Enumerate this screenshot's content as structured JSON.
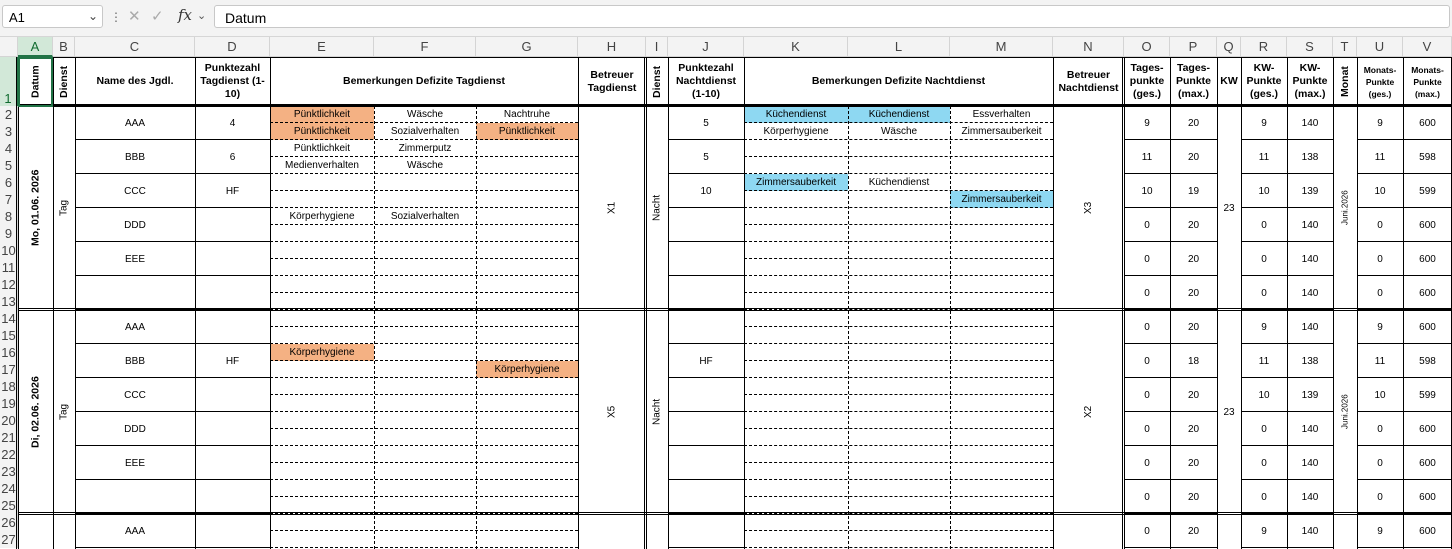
{
  "formula_bar": {
    "name_box": "A1",
    "dropdown_icon": "chevron-down-icon",
    "options_icon": "more-vertical-icon",
    "cancel_icon": "cancel-x-icon",
    "enter_icon": "checkmark-icon",
    "fx_label": "fx",
    "formula_value": "Datum"
  },
  "colors": {
    "orange_highlight": "#f4b183",
    "blue_highlight": "#8ed8f2",
    "selection_accent": "#217346"
  },
  "columns": [
    "A",
    "B",
    "C",
    "D",
    "E",
    "F",
    "G",
    "H",
    "I",
    "J",
    "K",
    "L",
    "M",
    "N",
    "O",
    "P",
    "Q",
    "R",
    "S",
    "T",
    "U",
    "V"
  ],
  "rows": [
    "1",
    "2",
    "3",
    "4",
    "5",
    "6",
    "7",
    "8",
    "9",
    "10",
    "11",
    "12",
    "13",
    "14",
    "15",
    "16",
    "17",
    "18",
    "19",
    "20",
    "21",
    "22",
    "23",
    "24",
    "25",
    "26",
    "27"
  ],
  "header": {
    "datum": "Datum",
    "dienst": "Dienst",
    "name": "Name des Jgdl.",
    "punktezahl_tag": "Punktezahl Tagdienst (1-10)",
    "bemerkungen_tag": "Bemerkungen Defizite Tagdienst",
    "betreuer_tag": "Betreuer Tagdienst",
    "dienst_nacht": "Dienst",
    "punktezahl_nacht": "Punktezahl Nachtdienst (1-10)",
    "bemerkungen_nacht": "Bemerkungen Defizite Nachtdienst",
    "betreuer_nacht": "Betreuer Nachtdienst",
    "tagespunkte_ges": "Tages-punkte (ges.)",
    "tagespunkte_max": "Tages-Punkte (max.)",
    "kw": "KW",
    "kw_punkte_ges": "KW-Punkte (ges.)",
    "kw_punkte_max": "KW-Punkte (max.)",
    "monat": "Monat",
    "monats_punkte_ges": "Monats-Punkte (ges.)",
    "monats_punkte_max": "Monats-Punkte (max.)"
  },
  "blocks": [
    {
      "date": "Mo, 01.06. 2026",
      "dienst_tag": "Tag",
      "betreuer_tag": "X1",
      "dienst_nacht": "Nacht",
      "betreuer_nacht": "X3",
      "kw": "23",
      "monat": "Juni.2026",
      "people": [
        {
          "name": "AAA",
          "pt_tag": "4",
          "pt_nacht": "5",
          "tages_ges": "9",
          "tages_max": "20",
          "kw_ges": "9",
          "kw_max": "140",
          "mon_ges": "9",
          "mon_max": "600"
        },
        {
          "name": "BBB",
          "pt_tag": "6",
          "pt_nacht": "5",
          "tages_ges": "11",
          "tages_max": "20",
          "kw_ges": "11",
          "kw_max": "138",
          "mon_ges": "11",
          "mon_max": "598"
        },
        {
          "name": "CCC",
          "pt_tag": "HF",
          "pt_nacht": "10",
          "tages_ges": "10",
          "tages_max": "19",
          "kw_ges": "10",
          "kw_max": "139",
          "mon_ges": "10",
          "mon_max": "599"
        },
        {
          "name": "DDD",
          "pt_tag": "",
          "pt_nacht": "",
          "tages_ges": "0",
          "tages_max": "20",
          "kw_ges": "0",
          "kw_max": "140",
          "mon_ges": "0",
          "mon_max": "600"
        },
        {
          "name": "EEE",
          "pt_tag": "",
          "pt_nacht": "",
          "tages_ges": "0",
          "tages_max": "20",
          "kw_ges": "0",
          "kw_max": "140",
          "mon_ges": "0",
          "mon_max": "600"
        },
        {
          "name": "",
          "pt_tag": "",
          "pt_nacht": "",
          "tages_ges": "0",
          "tages_max": "20",
          "kw_ges": "0",
          "kw_max": "140",
          "mon_ges": "0",
          "mon_max": "600"
        }
      ],
      "remarks_tag": [
        [
          "Pünktlichkeit",
          "Wäsche",
          "Nachtruhe"
        ],
        [
          "Pünktlichkeit",
          "Sozialverhalten",
          "Pünktlichkeit"
        ],
        [
          "Pünktlichkeit",
          "Zimmerputz",
          ""
        ],
        [
          "Medienverhalten",
          "Wäsche",
          ""
        ],
        [
          "",
          "",
          ""
        ],
        [
          "",
          "",
          ""
        ],
        [
          "Körperhygiene",
          "Sozialverhalten",
          ""
        ],
        [
          "",
          "",
          ""
        ],
        [
          "",
          "",
          ""
        ],
        [
          "",
          "",
          ""
        ],
        [
          "",
          "",
          ""
        ],
        [
          "",
          "",
          ""
        ]
      ],
      "remarks_nacht": [
        [
          "Küchendienst",
          "Küchendienst",
          "Essverhalten"
        ],
        [
          "Körperhygiene",
          "Wäsche",
          "Zimmersauberkeit"
        ],
        [
          "",
          "",
          ""
        ],
        [
          "",
          "",
          ""
        ],
        [
          "Zimmersauberkeit",
          "Küchendienst",
          ""
        ],
        [
          "",
          "",
          "Zimmersauberkeit"
        ],
        [
          "",
          "",
          ""
        ],
        [
          "",
          "",
          ""
        ],
        [
          "",
          "",
          ""
        ],
        [
          "",
          "",
          ""
        ],
        [
          "",
          "",
          ""
        ],
        [
          "",
          "",
          ""
        ]
      ],
      "highlights_tag": [
        [
          "orange",
          "",
          ""
        ],
        [
          "orange",
          "",
          "orange"
        ],
        [
          "",
          "",
          ""
        ],
        [
          "",
          "",
          ""
        ],
        [
          "",
          "",
          ""
        ],
        [
          "",
          "",
          ""
        ],
        [
          "",
          "",
          ""
        ],
        [
          "",
          "",
          ""
        ],
        [
          "",
          "",
          ""
        ],
        [
          "",
          "",
          ""
        ],
        [
          "",
          "",
          ""
        ],
        [
          "",
          "",
          ""
        ]
      ],
      "highlights_nacht": [
        [
          "blue",
          "blue",
          ""
        ],
        [
          "",
          "",
          ""
        ],
        [
          "",
          "",
          ""
        ],
        [
          "",
          "",
          ""
        ],
        [
          "blue",
          "",
          ""
        ],
        [
          "",
          "",
          "blue"
        ],
        [
          "",
          "",
          ""
        ],
        [
          "",
          "",
          ""
        ],
        [
          "",
          "",
          ""
        ],
        [
          "",
          "",
          ""
        ],
        [
          "",
          "",
          ""
        ],
        [
          "",
          "",
          ""
        ]
      ]
    },
    {
      "date": "Di, 02.06. 2026",
      "dienst_tag": "Tag",
      "betreuer_tag": "X5",
      "dienst_nacht": "Nacht",
      "betreuer_nacht": "X2",
      "kw": "23",
      "monat": "Juni.2026",
      "people": [
        {
          "name": "AAA",
          "pt_tag": "",
          "pt_nacht": "",
          "tages_ges": "0",
          "tages_max": "20",
          "kw_ges": "9",
          "kw_max": "140",
          "mon_ges": "9",
          "mon_max": "600"
        },
        {
          "name": "BBB",
          "pt_tag": "HF",
          "pt_nacht": "HF",
          "tages_ges": "0",
          "tages_max": "18",
          "kw_ges": "11",
          "kw_max": "138",
          "mon_ges": "11",
          "mon_max": "598"
        },
        {
          "name": "CCC",
          "pt_tag": "",
          "pt_nacht": "",
          "tages_ges": "0",
          "tages_max": "20",
          "kw_ges": "10",
          "kw_max": "139",
          "mon_ges": "10",
          "mon_max": "599"
        },
        {
          "name": "DDD",
          "pt_tag": "",
          "pt_nacht": "",
          "tages_ges": "0",
          "tages_max": "20",
          "kw_ges": "0",
          "kw_max": "140",
          "mon_ges": "0",
          "mon_max": "600"
        },
        {
          "name": "EEE",
          "pt_tag": "",
          "pt_nacht": "",
          "tages_ges": "0",
          "tages_max": "20",
          "kw_ges": "0",
          "kw_max": "140",
          "mon_ges": "0",
          "mon_max": "600"
        },
        {
          "name": "",
          "pt_tag": "",
          "pt_nacht": "",
          "tages_ges": "0",
          "tages_max": "20",
          "kw_ges": "0",
          "kw_max": "140",
          "mon_ges": "0",
          "mon_max": "600"
        }
      ],
      "remarks_tag": [
        [
          "",
          "",
          ""
        ],
        [
          "",
          "",
          ""
        ],
        [
          "Körperhygiene",
          "",
          ""
        ],
        [
          "",
          "",
          "Körperhygiene"
        ],
        [
          "",
          "",
          ""
        ],
        [
          "",
          "",
          ""
        ],
        [
          "",
          "",
          ""
        ],
        [
          "",
          "",
          ""
        ],
        [
          "",
          "",
          ""
        ],
        [
          "",
          "",
          ""
        ],
        [
          "",
          "",
          ""
        ],
        [
          "",
          "",
          ""
        ]
      ],
      "remarks_nacht": [
        [
          "",
          "",
          ""
        ],
        [
          "",
          "",
          ""
        ],
        [
          "",
          "",
          ""
        ],
        [
          "",
          "",
          ""
        ],
        [
          "",
          "",
          ""
        ],
        [
          "",
          "",
          ""
        ],
        [
          "",
          "",
          ""
        ],
        [
          "",
          "",
          ""
        ],
        [
          "",
          "",
          ""
        ],
        [
          "",
          "",
          ""
        ],
        [
          "",
          "",
          ""
        ],
        [
          "",
          "",
          ""
        ]
      ],
      "highlights_tag": [
        [
          "",
          "",
          ""
        ],
        [
          "",
          "",
          ""
        ],
        [
          "orange",
          "",
          ""
        ],
        [
          "",
          "",
          "orange"
        ],
        [
          "",
          "",
          ""
        ],
        [
          "",
          "",
          ""
        ],
        [
          "",
          "",
          ""
        ],
        [
          "",
          "",
          ""
        ],
        [
          "",
          "",
          ""
        ],
        [
          "",
          "",
          ""
        ],
        [
          "",
          "",
          ""
        ],
        [
          "",
          "",
          ""
        ]
      ],
      "highlights_nacht": [
        [
          "",
          "",
          ""
        ],
        [
          "",
          "",
          ""
        ],
        [
          "",
          "",
          ""
        ],
        [
          "",
          "",
          ""
        ],
        [
          "",
          "",
          ""
        ],
        [
          "",
          "",
          ""
        ],
        [
          "",
          "",
          ""
        ],
        [
          "",
          "",
          ""
        ],
        [
          "",
          "",
          ""
        ],
        [
          "",
          "",
          ""
        ],
        [
          "",
          "",
          ""
        ],
        [
          "",
          "",
          ""
        ]
      ]
    },
    {
      "partial": true,
      "people": [
        {
          "name": "AAA",
          "tages_ges": "0",
          "tages_max": "20",
          "kw_ges": "9",
          "kw_max": "140",
          "mon_ges": "9",
          "mon_max": "600"
        }
      ]
    }
  ]
}
